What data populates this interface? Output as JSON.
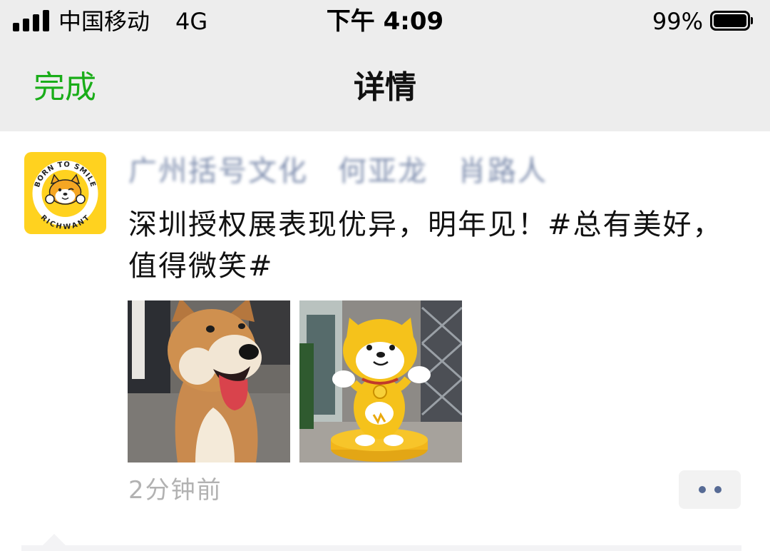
{
  "status_bar": {
    "carrier": "中国移动",
    "network": "4G",
    "time": "下午 4:09",
    "battery_percent": "99%",
    "battery_level": 0.99,
    "signal_bars": 4
  },
  "nav": {
    "done_label": "完成",
    "title": "详情",
    "done_color": "#1aad19"
  },
  "post": {
    "author": "广州括号文化　何亚龙　肖路人",
    "text": "深圳授权展表现优异，明年见！#总有美好，值得微笑#",
    "avatar": {
      "top_text": "BORN TO SMILE",
      "bottom_text": "RICHWANT",
      "icon": "shiba-mascot-logo"
    },
    "photos": [
      {
        "icon": "shiba-dog-photo"
      },
      {
        "icon": "yellow-shiba-statue-photo"
      }
    ],
    "time_ago": "2分钟前",
    "more_icon": "more-dots-icon",
    "link_color": "#576b95"
  }
}
